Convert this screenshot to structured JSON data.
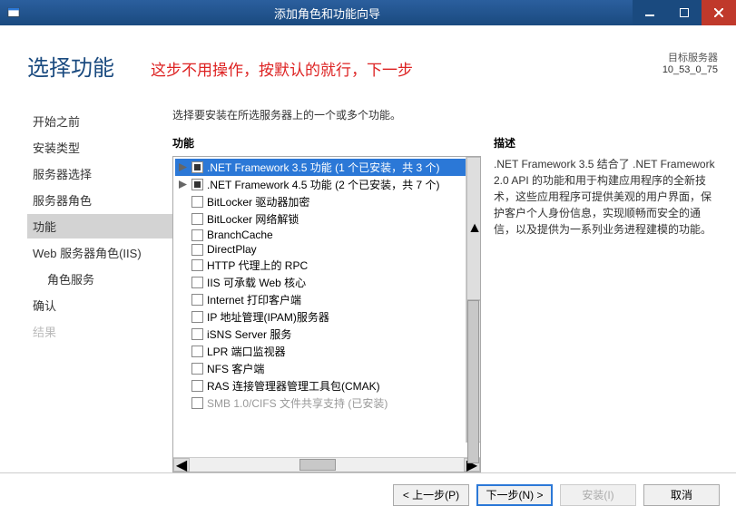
{
  "window": {
    "title": "添加角色和功能向导"
  },
  "header": {
    "page_title": "选择功能",
    "banner": "这步不用操作，按默认的就行，下一步",
    "dest_label": "目标服务器",
    "dest_value": "10_53_0_75"
  },
  "nav": {
    "items": [
      {
        "label": "开始之前"
      },
      {
        "label": "安装类型"
      },
      {
        "label": "服务器选择"
      },
      {
        "label": "服务器角色"
      },
      {
        "label": "功能",
        "selected": true
      },
      {
        "label": "Web 服务器角色(IIS)"
      },
      {
        "label": "角色服务",
        "sub": true
      },
      {
        "label": "确认"
      },
      {
        "label": "结果",
        "disabled": true
      }
    ]
  },
  "main": {
    "intro": "选择要安装在所选服务器上的一个或多个功能。",
    "features_head": "功能",
    "desc_head": "描述",
    "desc_text": ".NET Framework 3.5 结合了 .NET Framework 2.0 API 的功能和用于构建应用程序的全新技术，这些应用程序可提供美观的用户界面，保护客户个人身份信息，实现顺畅而安全的通信，以及提供为一系列业务进程建模的功能。",
    "tree": [
      {
        "expand": true,
        "check": "partial",
        "label": ".NET Framework 3.5 功能 (1 个已安装，共 3 个)",
        "selected": true
      },
      {
        "expand": true,
        "check": "partial",
        "label": ".NET Framework 4.5 功能 (2 个已安装，共 7 个)"
      },
      {
        "check": "none",
        "label": "BitLocker 驱动器加密"
      },
      {
        "check": "none",
        "label": "BitLocker 网络解锁"
      },
      {
        "check": "none",
        "label": "BranchCache"
      },
      {
        "check": "none",
        "label": "DirectPlay"
      },
      {
        "check": "none",
        "label": "HTTP 代理上的 RPC"
      },
      {
        "check": "none",
        "label": "IIS 可承载 Web 核心"
      },
      {
        "check": "none",
        "label": "Internet 打印客户端"
      },
      {
        "check": "none",
        "label": "IP 地址管理(IPAM)服务器"
      },
      {
        "check": "none",
        "label": "iSNS Server 服务"
      },
      {
        "check": "none",
        "label": "LPR 端口监视器"
      },
      {
        "check": "none",
        "label": "NFS 客户端"
      },
      {
        "check": "none",
        "label": "RAS 连接管理器管理工具包(CMAK)"
      },
      {
        "check": "none",
        "label": "SMB 1.0/CIFS 文件共享支持 (已安装)",
        "dim": true
      }
    ]
  },
  "footer": {
    "prev": "< 上一步(P)",
    "next": "下一步(N) >",
    "install": "安装(I)",
    "cancel": "取消"
  }
}
